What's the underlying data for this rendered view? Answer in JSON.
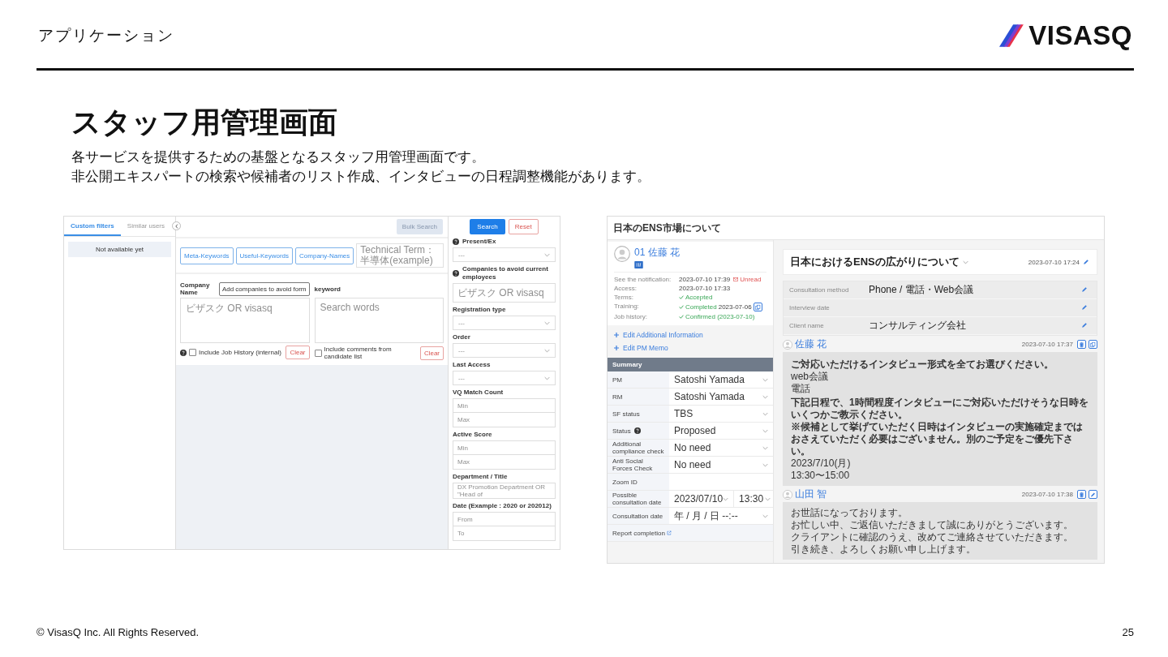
{
  "header": {
    "section": "アプリケーション",
    "logo_text": "VISASQ"
  },
  "title": "スタッフ用管理画面",
  "description": [
    "各サービスを提供するための基盤となるスタッフ用管理画面です。",
    "非公開エキスパートの検索や候補者のリスト作成、インタビューの日程調整機能があります。"
  ],
  "search_screen": {
    "tabs": [
      {
        "label": "Custom filters",
        "selected": true
      },
      {
        "label": "Similar users",
        "selected": false
      }
    ],
    "empty_note": "Not available yet",
    "bulk_button": {
      "label": "Bulk Search",
      "disabled": true
    },
    "keyword_buttons": [
      "Meta-Keywords",
      "Useful-Keywords",
      "Company-Names"
    ],
    "term_field": {
      "placeholder": "Technical Term：半導体(example)"
    },
    "company": {
      "label": "Company Name",
      "button": "Add companies to avoid form",
      "placeholder": "ビザスク OR visasq",
      "help": true,
      "checkbox": {
        "label": "Include Job History (internal)",
        "checked": false
      },
      "clear": "Clear"
    },
    "keyword": {
      "label": "keyword",
      "placeholder": "Search words",
      "help": false,
      "checkbox": {
        "label": "Include comments from candidate list",
        "checked": false
      },
      "clear": "Clear"
    },
    "search_button": "Search",
    "reset_button": "Reset",
    "filters": [
      {
        "kind": "select",
        "label": "Present/Ex",
        "help": true,
        "placeholder": "---"
      },
      {
        "kind": "textarea",
        "label": "Companies to avoid current employees",
        "help": true,
        "placeholder": "ビザスク OR visasq"
      },
      {
        "kind": "select",
        "label": "Registration type",
        "help": false,
        "placeholder": "---"
      },
      {
        "kind": "select",
        "label": "Order",
        "help": false,
        "placeholder": "---"
      },
      {
        "kind": "select",
        "label": "Last Access",
        "help": false,
        "placeholder": "---"
      },
      {
        "kind": "range",
        "label": "VQ Match Count",
        "help": false,
        "placeholders": [
          "Min",
          "Max"
        ]
      },
      {
        "kind": "range",
        "label": "Active Score",
        "help": false,
        "placeholders": [
          "Min",
          "Max"
        ]
      },
      {
        "kind": "text",
        "label": "Department / Title",
        "help": false,
        "placeholder": "DX Promotion Department OR \"Head of"
      },
      {
        "kind": "range",
        "label": "Date (Example : 2020 or 202012)",
        "help": false,
        "placeholders": [
          "From",
          "To"
        ]
      }
    ]
  },
  "detail_screen": {
    "title": "日本のENS市場について",
    "profile": {
      "name": "01 佐藤 花",
      "rows": [
        {
          "kind": "date_unread",
          "label": "See the notification:",
          "value": "2023-07-10 17:39",
          "status": "Unread"
        },
        {
          "kind": "date",
          "label": "Access:",
          "value": "2023-07-10 17:33"
        },
        {
          "kind": "check",
          "label": "Terms:",
          "status": "Accepted"
        },
        {
          "kind": "check_date_copy",
          "label": "Training:",
          "status": "Completed",
          "value": "2023-07-06"
        },
        {
          "kind": "check",
          "label": "Job history:",
          "status": "Confirmed (2023-07-10)"
        }
      ]
    },
    "links": [
      "Edit Additional Information",
      "Edit PM Memo"
    ],
    "summary": {
      "heading": "Summary",
      "rows": [
        {
          "kind": "select",
          "label": "PM",
          "help": false,
          "value": "Satoshi Yamada"
        },
        {
          "kind": "select",
          "label": "RM",
          "help": false,
          "value": "Satoshi Yamada"
        },
        {
          "kind": "select",
          "label": "SF status",
          "help": false,
          "value": "TBS"
        },
        {
          "kind": "select",
          "label": "Status",
          "help": true,
          "value": "Proposed"
        },
        {
          "kind": "select",
          "label": "Additional compliance check",
          "help": false,
          "value": "No need"
        },
        {
          "kind": "select",
          "label": "Anti Social Forces Check",
          "help": false,
          "value": "No need"
        },
        {
          "kind": "empty",
          "label": "Zoom ID",
          "help": false
        },
        {
          "kind": "datetime",
          "label": "Possible consultation date",
          "help": false,
          "date": "2023/07/10",
          "time": "13:30"
        },
        {
          "kind": "select",
          "label": "Consultation date",
          "help": false,
          "value": "年 / 月 / 日 --:--"
        },
        {
          "kind": "link",
          "label": "Report completion",
          "help": false
        }
      ]
    },
    "topic": {
      "title": "日本におけるENSの広がりについて",
      "date": "2023-07-10 17:24"
    },
    "fields": [
      {
        "label": "Consultation method",
        "value": "Phone / 電話・Web会議"
      },
      {
        "label": "Interview date"
      },
      {
        "label": "Client name",
        "value": "コンサルティング会社"
      }
    ],
    "comments": [
      {
        "author": "佐藤 花",
        "date": "2023-07-10 17:37",
        "kind": "copy",
        "lines": [
          {
            "text": "ご対応いただけるインタビュー形式を全てお選びください。",
            "bold": true
          },
          {
            "text": "web会議",
            "bold": false
          },
          {
            "text": "電話",
            "bold": false
          },
          {
            "text": "下記日程で、1時間程度インタビューにご対応いただけそうな日時をいくつかご教示ください。",
            "bold": true
          },
          {
            "text": "※候補として挙げていただく日時はインタビューの実施確定まではおさえていただく必要はございません。別のご予定をご優先下さい。",
            "bold": true
          },
          {
            "text": "2023/7/10(月)",
            "bold": false
          },
          {
            "text": "13:30〜15:00",
            "bold": false
          }
        ]
      },
      {
        "author": "山田 智",
        "date": "2023-07-10 17:38",
        "kind": "edit",
        "lines": [
          {
            "text": "お世話になっております。",
            "bold": false
          },
          {
            "text": "お忙しい中、ご返信いただきまして誠にありがとうございます。",
            "bold": false
          },
          {
            "text": "クライアントに確認のうえ、改めてご連絡させていただきます。",
            "bold": false
          },
          {
            "text": "引き続き、よろしくお願い申し上げます。",
            "bold": false
          }
        ]
      }
    ]
  },
  "footer": {
    "copyright": "© VisasQ Inc. All Rights Reserved.",
    "page": "25"
  }
}
